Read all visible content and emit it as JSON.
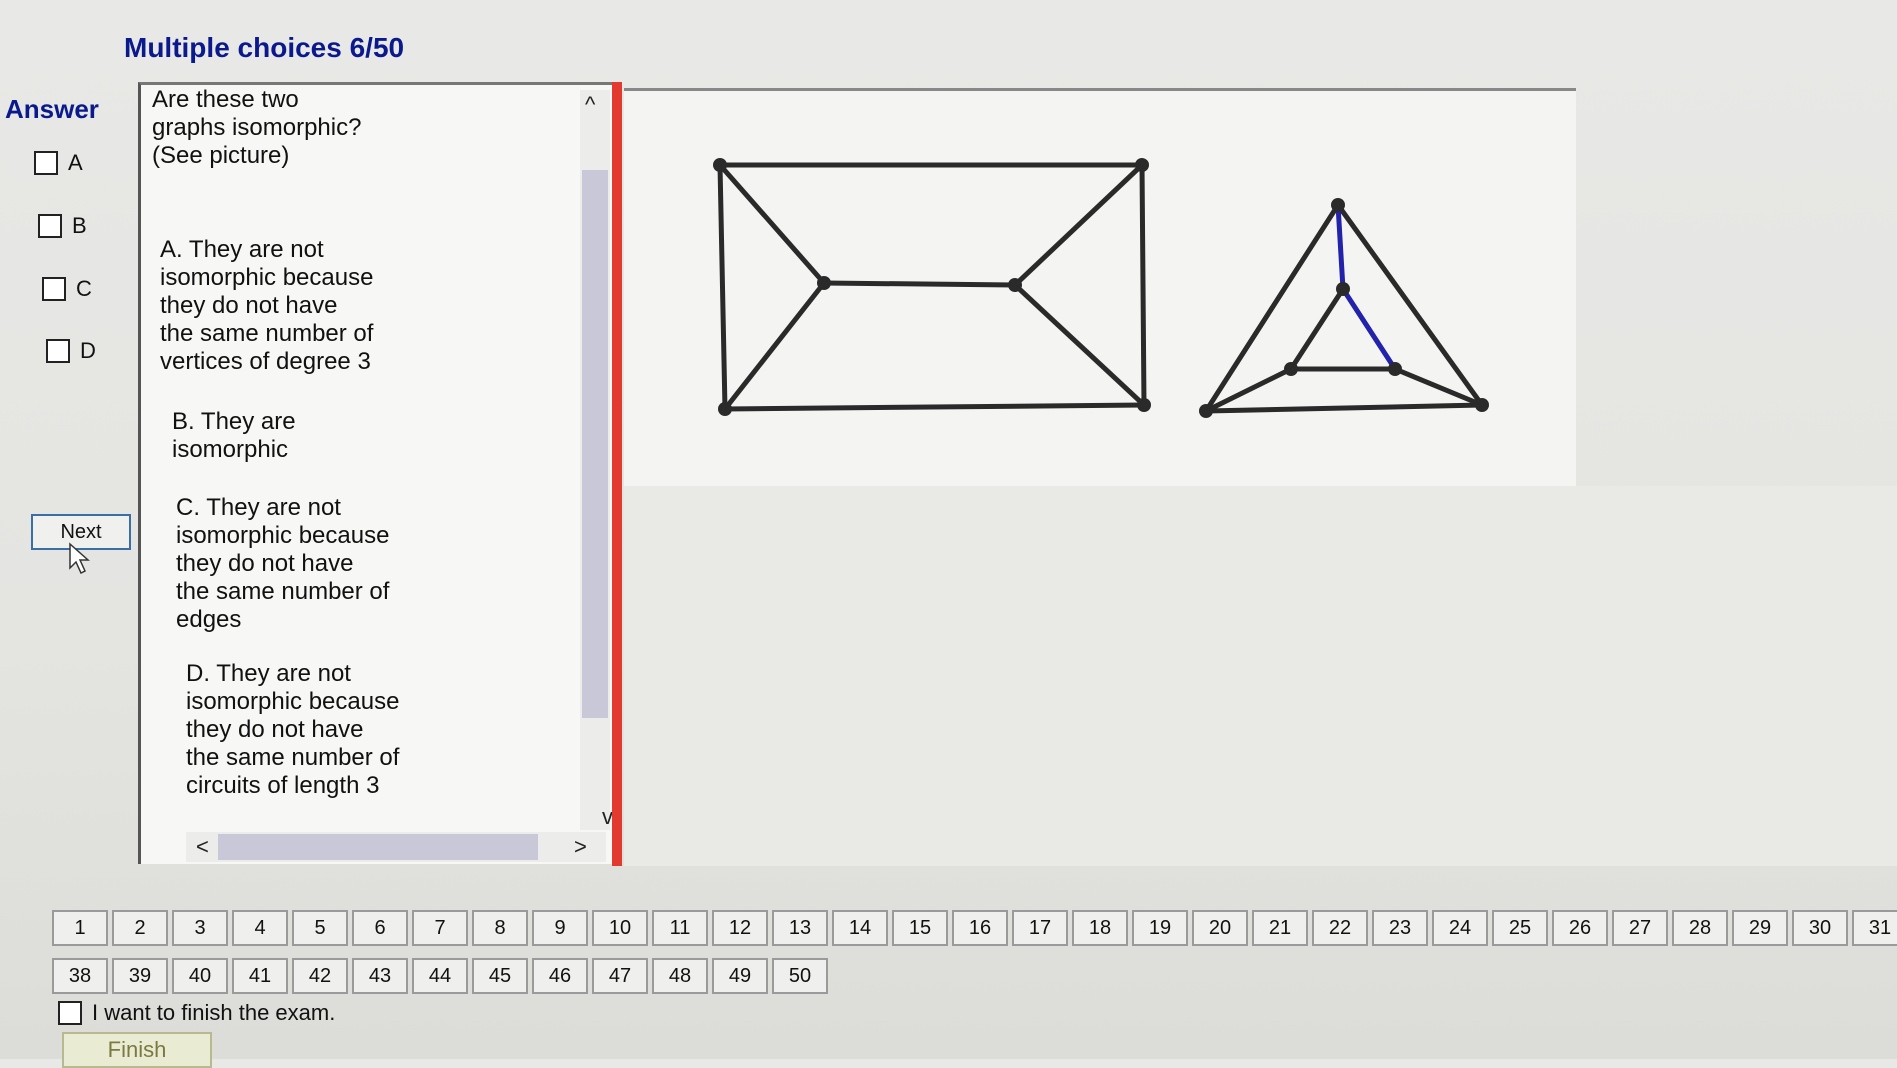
{
  "header": {
    "title": "Multiple choices 6/50"
  },
  "answers": {
    "label": "Answer",
    "options": [
      "A",
      "B",
      "C",
      "D"
    ]
  },
  "next_label": "Next",
  "question": {
    "prompt": "Are these two\ngraphs isomorphic?\n(See picture)",
    "choices": [
      "A.  They are not\nisomorphic because\nthey do not have\nthe same number of\nvertices of degree 3",
      "B.  They are\nisomorphic",
      "C.  They are not\nisomorphic because\nthey do not have\nthe same number of\nedges",
      "D.  They are not\nisomorphic because\nthey do not have\nthe same number of\ncircuits of length 3"
    ]
  },
  "scroll_glyphs": {
    "up": "^",
    "down": "v",
    "left": "<",
    "right": ">"
  },
  "nav": {
    "row1": [
      "1",
      "2",
      "3",
      "4",
      "5",
      "6",
      "7",
      "8",
      "9",
      "10",
      "11",
      "12",
      "13",
      "14",
      "15",
      "16",
      "17",
      "18",
      "19",
      "20",
      "21",
      "22",
      "23",
      "24",
      "25",
      "26",
      "27",
      "28",
      "29",
      "30",
      "31"
    ],
    "row2": [
      "38",
      "39",
      "40",
      "41",
      "42",
      "43",
      "44",
      "45",
      "46",
      "47",
      "48",
      "49",
      "50"
    ]
  },
  "finish": {
    "checkbox_label": "I want to finish the exam.",
    "button_label": "Finish"
  },
  "colors": {
    "title": "#0a1a8c",
    "scroll_marker": "#e23a2e",
    "graph_edge": "#2a2a2a",
    "graph_highlight": "#2222aa"
  },
  "icons": [
    "cursor-arrow-icon",
    "chevron-up-icon",
    "chevron-down-icon",
    "chevron-left-icon",
    "chevron-right-icon"
  ]
}
